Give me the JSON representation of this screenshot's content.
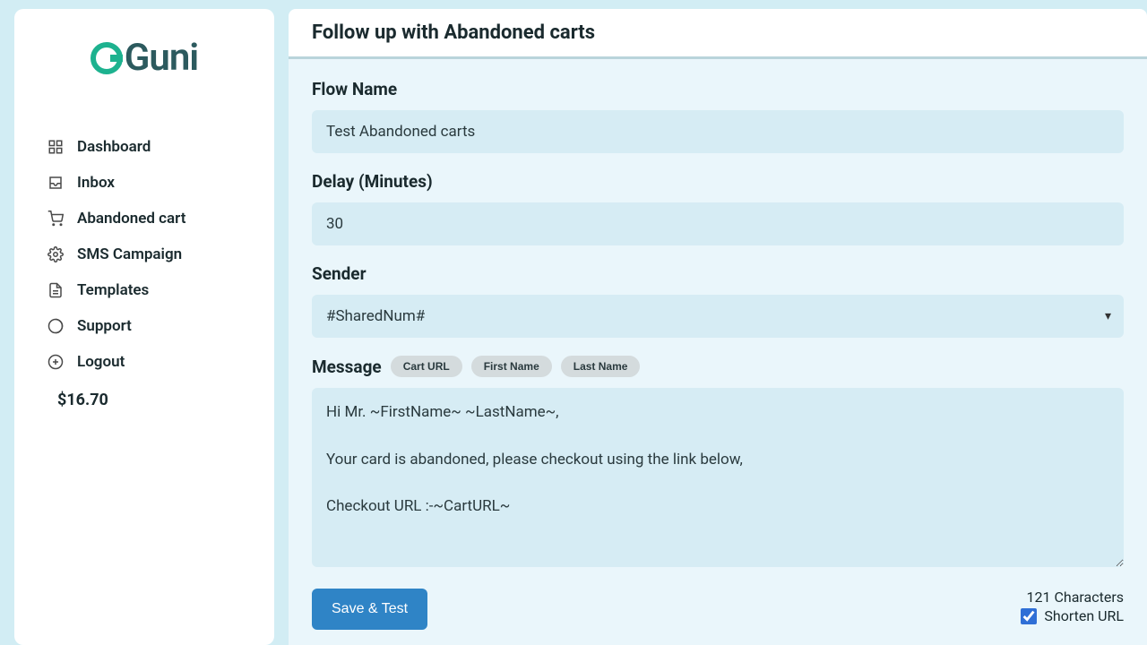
{
  "brand": {
    "name": "Guni"
  },
  "sidebar": {
    "items": [
      {
        "label": "Dashboard",
        "icon": "dashboard-icon"
      },
      {
        "label": "Inbox",
        "icon": "inbox-icon"
      },
      {
        "label": "Abandoned cart",
        "icon": "cart-icon"
      },
      {
        "label": "SMS Campaign",
        "icon": "campaign-icon"
      },
      {
        "label": "Templates",
        "icon": "templates-icon"
      },
      {
        "label": "Support",
        "icon": "support-icon"
      },
      {
        "label": "Logout",
        "icon": "logout-icon"
      }
    ],
    "balance": "$16.70"
  },
  "header": {
    "title": "Follow up with Abandoned carts"
  },
  "form": {
    "flow_name_label": "Flow Name",
    "flow_name_value": "Test Abandoned carts",
    "delay_label": "Delay (Minutes)",
    "delay_value": "30",
    "sender_label": "Sender",
    "sender_selected": "#SharedNum#",
    "message_label": "Message",
    "chips": [
      "Cart URL",
      "First Name",
      "Last Name"
    ],
    "message_value": "Hi Mr. ~FirstName~ ~LastName~,\n\nYour card is abandoned, please checkout using the link below,\n\nCheckout URL :-~CartURL~",
    "char_count": "121 Characters",
    "shorten_label": "Shorten URL",
    "shorten_checked": true,
    "save_label": "Save & Test"
  }
}
